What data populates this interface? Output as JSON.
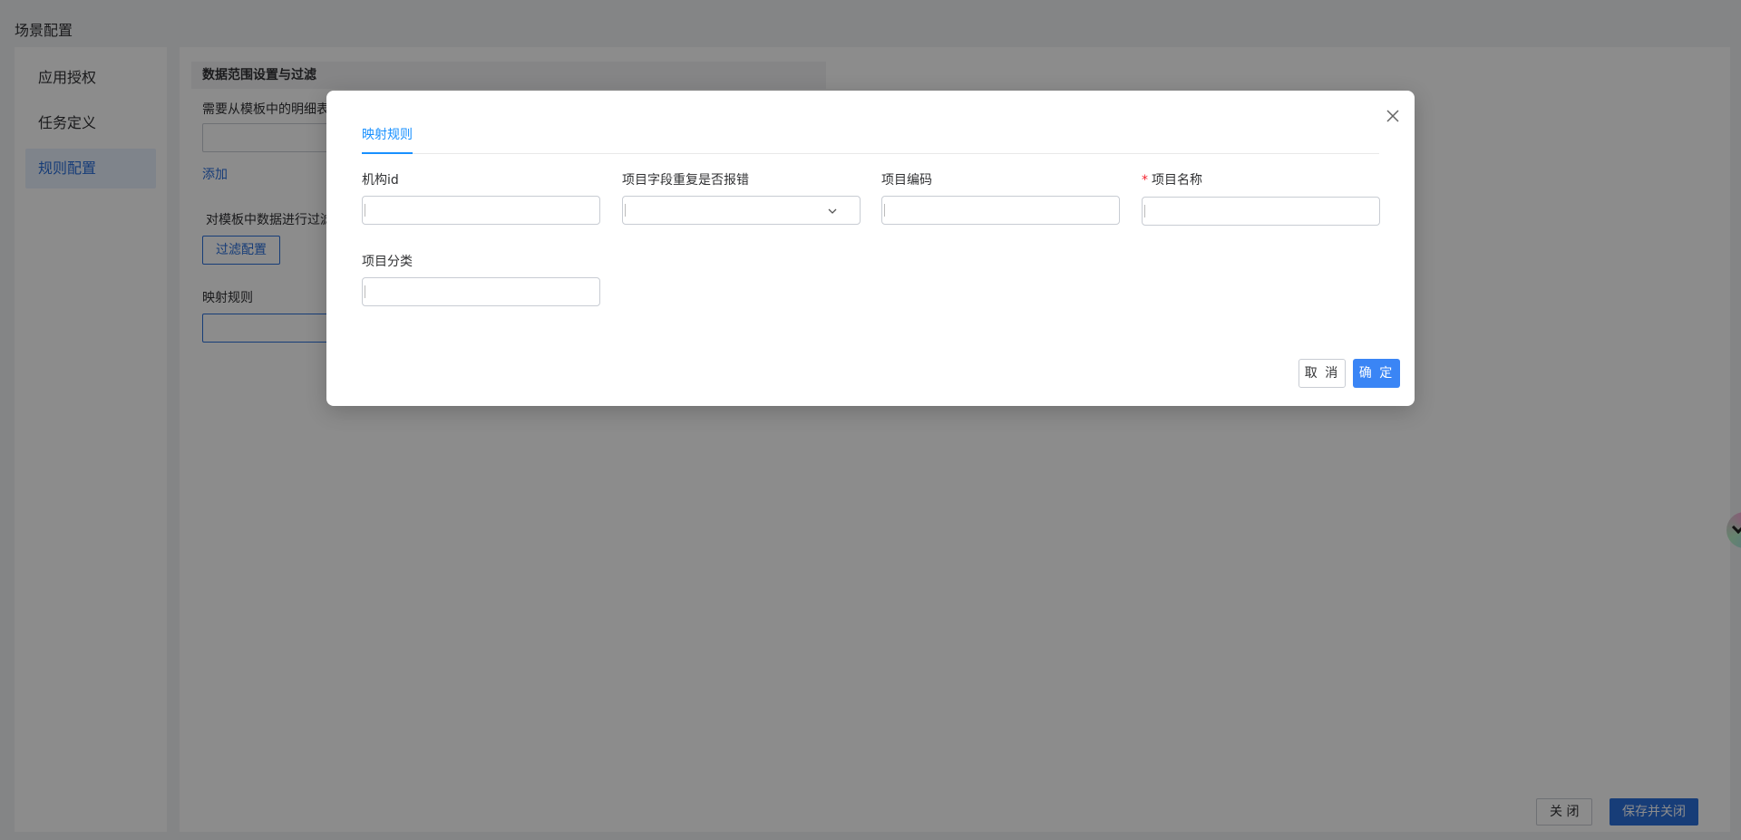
{
  "page": {
    "title": "场景配置"
  },
  "nav": {
    "items": [
      {
        "label": "应用授权"
      },
      {
        "label": "任务定义"
      },
      {
        "label": "规则配置",
        "active": true
      }
    ]
  },
  "content": {
    "section_title": "数据范围设置与过滤",
    "detail_label": "需要从模板中的明细表",
    "add_link": "添加",
    "filter_label": "对模板中数据进行过滤",
    "filter_button": "过滤配置",
    "mapping_label": "映射规则"
  },
  "footer": {
    "close_label": "关 闭",
    "save_close_label": "保存并关闭"
  },
  "dialog": {
    "tab_label": "映射规则",
    "fields": {
      "org_id": {
        "label": "机构id",
        "value": ""
      },
      "dup_error": {
        "label": "项目字段重复是否报错",
        "value": ""
      },
      "code": {
        "label": "项目编码",
        "value": ""
      },
      "name": {
        "label": "项目名称",
        "required_mark": "*",
        "value": ""
      },
      "category": {
        "label": "项目分类",
        "value": ""
      }
    },
    "cancel_label": "取 消",
    "ok_label": "确 定"
  },
  "colors": {
    "primary": "#3a85f5",
    "tab_active": "#1890ff",
    "required": "#f5222d",
    "nav_active": "#2a6fdb"
  }
}
